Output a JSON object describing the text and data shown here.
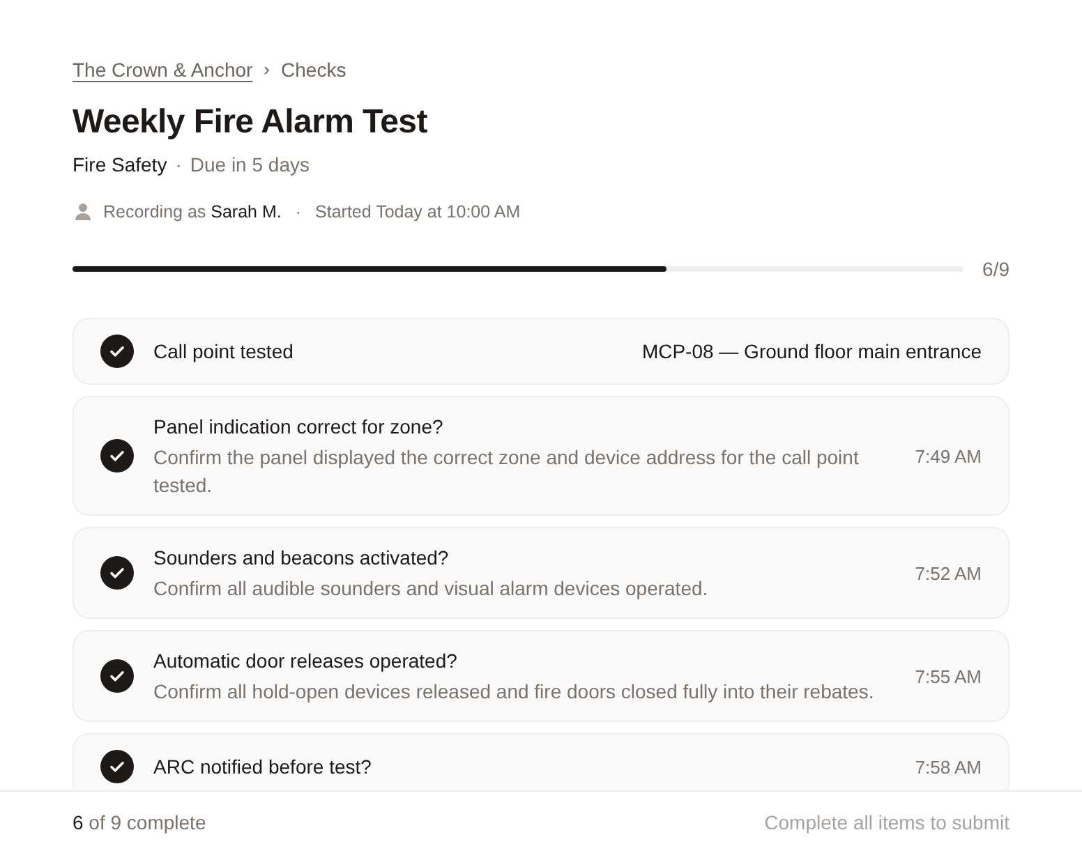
{
  "breadcrumb": {
    "items": [
      {
        "label": "The Crown & Anchor",
        "kind": "link"
      },
      {
        "label": "Checks",
        "kind": "current"
      }
    ],
    "separator": "›"
  },
  "header": {
    "title": "Weekly Fire Alarm Test",
    "category": "Fire Safety",
    "separator": "·",
    "due": "Due in 5 days"
  },
  "recorder": {
    "text": "Recording as **Sarah M.**",
    "separator": "·",
    "started": "Started Today at 10:00 AM"
  },
  "progress": {
    "level": 0.667,
    "reading": "6/9"
  },
  "items": [
    {
      "kind": "value",
      "title": "Call point tested",
      "value": "MCP-08 — Ground floor main entrance",
      "checked": true
    },
    {
      "kind": "question",
      "title": "Panel indication correct for zone?",
      "description": "Confirm the panel displayed the correct zone and device address for the call point tested.",
      "time": "7:49 AM",
      "checked": true
    },
    {
      "kind": "question",
      "title": "Sounders and beacons activated?",
      "description": "Confirm all audible sounders and visual alarm devices operated.",
      "time": "7:52 AM",
      "checked": true
    },
    {
      "kind": "question",
      "title": "Automatic door releases operated?",
      "description": "Confirm all hold-open devices released and fire doors closed fully into their rebates.",
      "time": "7:55 AM",
      "checked": true
    },
    {
      "kind": "question",
      "title": "ARC notified before test?",
      "time": "7:58 AM",
      "checked": true
    }
  ],
  "footer": {
    "summary": "**6** of 9 complete",
    "submit": {
      "label": "Complete all items to submit",
      "disabled": true
    }
  }
}
